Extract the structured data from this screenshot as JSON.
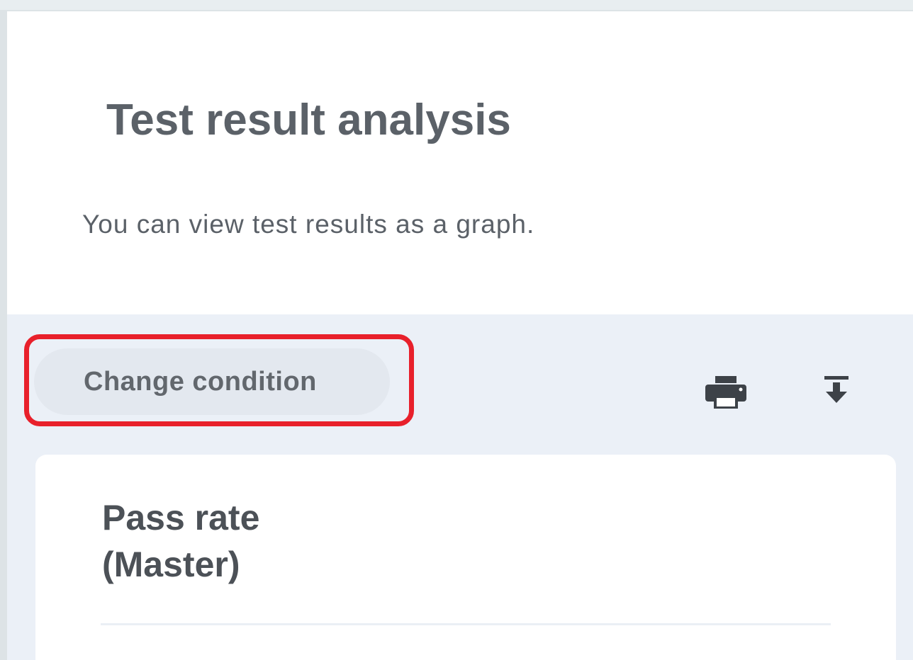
{
  "header": {
    "title": "Test result analysis",
    "description": "You can view test results as a graph."
  },
  "toolbar": {
    "change_condition_label": "Change condition",
    "print_icon": "printer-icon",
    "download_icon": "download-icon"
  },
  "card": {
    "title_line1": "Pass rate",
    "title_line2": "(Master)"
  },
  "colors": {
    "highlight": "#e8202b",
    "toolbar_bg": "#ebf0f7",
    "text": "#5b6168"
  }
}
